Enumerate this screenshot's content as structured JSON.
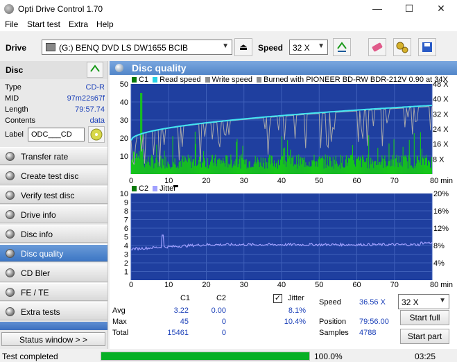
{
  "window": {
    "title": "Opti Drive Control 1.70",
    "min": "—",
    "max": "☐",
    "close": "✕"
  },
  "menu": [
    "File",
    "Start test",
    "Extra",
    "Help"
  ],
  "toolbar": {
    "drive_label": "Drive",
    "drive_value": "(G:)  BENQ DVD LS DW1655 BCIB",
    "speed_label": "Speed",
    "speed_value": "32 X"
  },
  "disc": {
    "header": "Disc",
    "rows": [
      {
        "k": "Type",
        "v": "CD-R"
      },
      {
        "k": "MID",
        "v": "97m22s67f"
      },
      {
        "k": "Length",
        "v": "79:57.74"
      },
      {
        "k": "Contents",
        "v": "data"
      }
    ],
    "label_key": "Label",
    "label_value": "ODC___CD"
  },
  "nav": [
    {
      "label": "Transfer rate"
    },
    {
      "label": "Create test disc"
    },
    {
      "label": "Verify test disc"
    },
    {
      "label": "Drive info"
    },
    {
      "label": "Disc info"
    },
    {
      "label": "Disc quality"
    },
    {
      "label": "CD Bler"
    },
    {
      "label": "FE / TE"
    },
    {
      "label": "Extra tests"
    }
  ],
  "status_window_btn": "Status window > >",
  "panel_title": "Disc quality",
  "chart_data": [
    {
      "type": "area",
      "legend": [
        "C1",
        "Read speed",
        "Write speed",
        "Burned with PIONEER BD-RW   BDR-212V 0.90 at 34X"
      ],
      "colors": {
        "c1": "#16c61a",
        "read": "#43e6f2",
        "write": "#a9a9a9",
        "legend_sq_c1": "#0a7a0a",
        "legend_sq_read": "#27d3e6",
        "legend_sq_write": "#8f8f8f"
      },
      "x_ticks": [
        "0",
        "10",
        "20",
        "30",
        "40",
        "50",
        "60",
        "70",
        "80 min"
      ],
      "y_ticks_left": [
        "50",
        "40",
        "30",
        "20",
        "10"
      ],
      "y_ticks_right": [
        "48 X",
        "40 X",
        "32 X",
        "24 X",
        "16 X",
        "8 X"
      ],
      "xlim": [
        0,
        80
      ],
      "ylim": [
        0,
        50
      ],
      "c1_avg": 3.22,
      "c1_max": 45,
      "read_speed_start": 18,
      "read_speed_end": 36.56
    },
    {
      "type": "line",
      "legend": [
        "C2",
        "Jitter"
      ],
      "colors": {
        "c2": "#0a7a0a",
        "jitter": "#a0a0ff"
      },
      "x_ticks": [
        "0",
        "10",
        "20",
        "30",
        "40",
        "50",
        "60",
        "70",
        "80 min"
      ],
      "y_ticks_left": [
        "10",
        "9",
        "8",
        "7",
        "6",
        "5",
        "4",
        "3",
        "2",
        "1"
      ],
      "y_ticks_right": [
        "20%",
        "16%",
        "12%",
        "8%",
        "4%"
      ],
      "xlim": [
        0,
        80
      ],
      "ylim": [
        0,
        10
      ],
      "jitter_avg": 8.1,
      "jitter_max": 10.4
    }
  ],
  "stats": {
    "col_c1": "C1",
    "col_c2": "C2",
    "rows": [
      {
        "k": "Avg",
        "c1": "3.22",
        "c2": "0.00",
        "j": "8.1%"
      },
      {
        "k": "Max",
        "c1": "45",
        "c2": "0",
        "j": "10.4%"
      },
      {
        "k": "Total",
        "c1": "15461",
        "c2": "0",
        "j": ""
      }
    ],
    "jitter_label": "Jitter",
    "speed_label": "Speed",
    "speed_value": "36.56 X",
    "position_label": "Position",
    "position_value": "79:56.00",
    "samples_label": "Samples",
    "samples_value": "4788",
    "speed_combo": "32 X",
    "start_full": "Start full",
    "start_part": "Start part"
  },
  "status": {
    "text": "Test completed",
    "percent": "100.0%",
    "time": "03:25",
    "progress": 1.0
  }
}
